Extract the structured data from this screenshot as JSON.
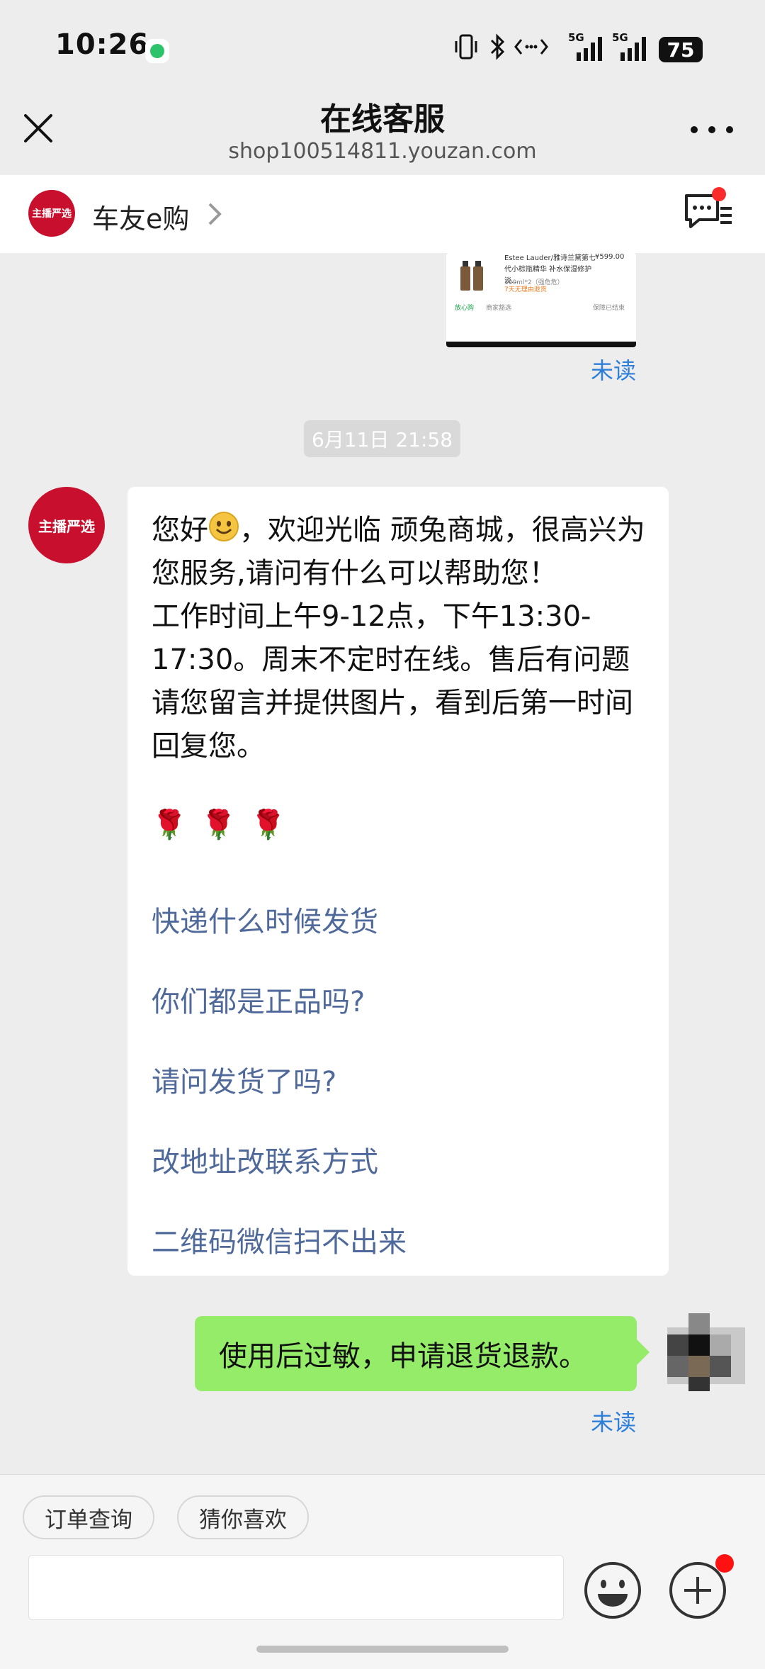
{
  "status_bar": {
    "time": "10:26",
    "network_1": "5G",
    "network_2": "5G",
    "battery": "75"
  },
  "title_bar": {
    "title": "在线客服",
    "url": "shop100514811.youzan.com"
  },
  "shop": {
    "name": "车友e购",
    "avatar_text": "主播严选"
  },
  "previous_card": {
    "title": "Estee Lauder/雅诗兰黛第七代小棕瓶精华 补水保湿修护淡…",
    "spec": "100ml*2（强危危）",
    "price": "¥599.00",
    "promo": "7天无理由退货",
    "safe_label": "放心购",
    "safe_note": "商家豁选",
    "status": "保障已结束"
  },
  "unread_label": "未读",
  "timestamp": "6月11日 21:58",
  "agent_message": {
    "avatar_text": "主播严选",
    "greeting_before_emoji": "您好",
    "greeting_after_emoji": "，欢迎光临 顽兔商城，很高兴为您服务,请问有什么可以帮助您！",
    "hours": "工作时间上午9-12点，下午13:30-17:30。周末不定时在线。售后有问题请您留言并提供图片，看到后第一时间回复您。",
    "roses": "🌹🌹🌹",
    "quick_replies": [
      "快递什么时候发货",
      "你们都是正品吗?",
      "请问发货了吗?",
      "改地址改联系方式",
      "二维码微信扫不出来"
    ]
  },
  "user_message": {
    "text": "使用后过敏，申请退货退款。"
  },
  "bottom": {
    "chips": [
      "订单查询",
      "猜你喜欢"
    ],
    "input_value": ""
  },
  "colors": {
    "accent_link": "#4f6a9a",
    "unread": "#2d7fd9",
    "user_bubble": "#95ec69",
    "brand_red": "#c8102e"
  },
  "icons": [
    "close-icon",
    "more-icon",
    "chevron-right-icon",
    "chat-list-icon",
    "emoji-icon",
    "plus-icon"
  ]
}
